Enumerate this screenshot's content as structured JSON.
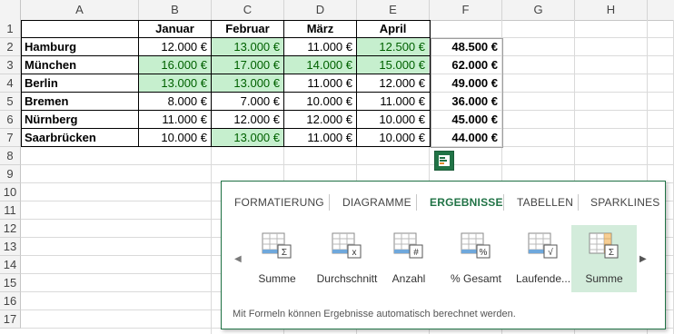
{
  "columns": [
    "A",
    "B",
    "C",
    "D",
    "E",
    "F",
    "G",
    "H"
  ],
  "rows": [
    "1",
    "2",
    "3",
    "4",
    "5",
    "6",
    "7",
    "8",
    "9",
    "10",
    "11",
    "12",
    "13",
    "14",
    "15",
    "16",
    "17"
  ],
  "headers": [
    "Januar",
    "Februar",
    "März",
    "April"
  ],
  "table": [
    {
      "city": "Hamburg",
      "values": [
        "12.000 €",
        "13.000 €",
        "11.000 €",
        "12.500 €"
      ],
      "green": [
        false,
        true,
        false,
        true
      ],
      "total": "48.500 €"
    },
    {
      "city": "München",
      "values": [
        "16.000 €",
        "17.000 €",
        "14.000 €",
        "15.000 €"
      ],
      "green": [
        true,
        true,
        true,
        true
      ],
      "total": "62.000 €"
    },
    {
      "city": "Berlin",
      "values": [
        "13.000 €",
        "13.000 €",
        "11.000 €",
        "12.000 €"
      ],
      "green": [
        true,
        true,
        false,
        false
      ],
      "total": "49.000 €"
    },
    {
      "city": "Bremen",
      "values": [
        "8.000 €",
        "7.000 €",
        "10.000 €",
        "11.000 €"
      ],
      "green": [
        false,
        false,
        false,
        false
      ],
      "total": "36.000 €"
    },
    {
      "city": "Nürnberg",
      "values": [
        "11.000 €",
        "12.000 €",
        "12.000 €",
        "10.000 €"
      ],
      "green": [
        false,
        false,
        false,
        false
      ],
      "total": "45.000 €"
    },
    {
      "city": "Saarbrücken",
      "values": [
        "10.000 €",
        "13.000 €",
        "11.000 €",
        "10.000 €"
      ],
      "green": [
        false,
        true,
        false,
        false
      ],
      "total": "44.000 €"
    }
  ],
  "quick_analysis": {
    "tabs": [
      "FORMATIERUNG",
      "DIAGRAMME",
      "ERGEBNISSE",
      "TABELLEN",
      "SPARKLINES"
    ],
    "active_tab": "ERGEBNISSE",
    "options": [
      "Summe",
      "Durchschnitt",
      "Anzahl",
      "% Gesamt",
      "Laufende...",
      "Summe"
    ],
    "selected_option": 5,
    "description": "Mit Formeln können Ergebnisse automatisch berechnet werden."
  },
  "colors": {
    "accent": "#217346",
    "green_fill": "#c6efce",
    "green_text": "#006100"
  }
}
